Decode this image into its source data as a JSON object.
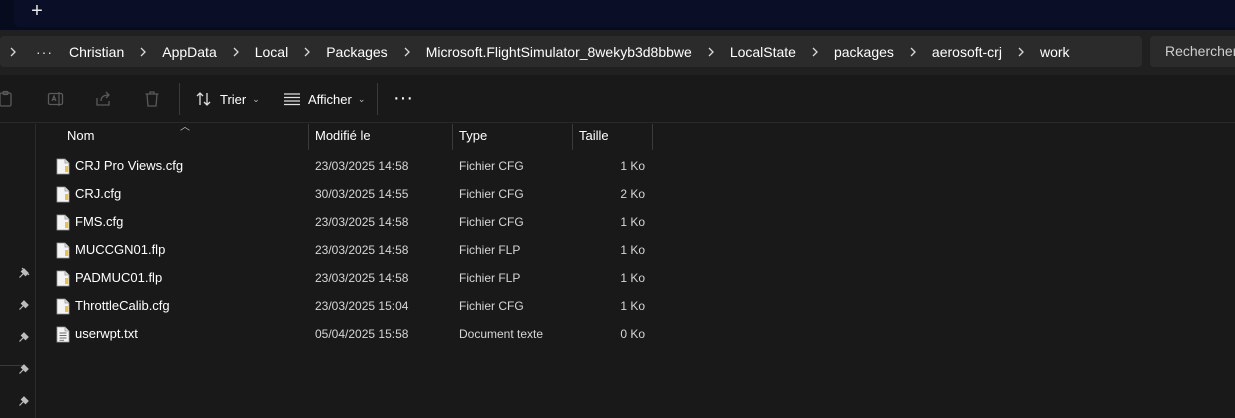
{
  "tabbar": {
    "new_tab": "+"
  },
  "address": {
    "overflow": "···",
    "crumbs": [
      "Christian",
      "AppData",
      "Local",
      "Packages",
      "Microsoft.FlightSimulator_8wekyb3d8bbwe",
      "LocalState",
      "packages",
      "aerosoft-crj",
      "work"
    ]
  },
  "search": {
    "placeholder": "Rechercher"
  },
  "toolbar": {
    "sort_label": "Trier",
    "view_label": "Afficher",
    "more_label": "···"
  },
  "columns": {
    "name": "Nom",
    "modified": "Modifié le",
    "type": "Type",
    "size": "Taille"
  },
  "files": [
    {
      "name": "CRJ Pro Views.cfg",
      "modified": "23/03/2025 14:58",
      "type": "Fichier CFG",
      "size": "1 Ko",
      "icon": "config-file-icon"
    },
    {
      "name": "CRJ.cfg",
      "modified": "30/03/2025 14:55",
      "type": "Fichier CFG",
      "size": "2 Ko",
      "icon": "config-file-icon"
    },
    {
      "name": "FMS.cfg",
      "modified": "23/03/2025 14:58",
      "type": "Fichier CFG",
      "size": "1 Ko",
      "icon": "config-file-icon"
    },
    {
      "name": "MUCCGN01.flp",
      "modified": "23/03/2025 14:58",
      "type": "Fichier FLP",
      "size": "1 Ko",
      "icon": "config-file-icon"
    },
    {
      "name": "PADMUC01.flp",
      "modified": "23/03/2025 14:58",
      "type": "Fichier FLP",
      "size": "1 Ko",
      "icon": "config-file-icon"
    },
    {
      "name": "ThrottleCalib.cfg",
      "modified": "23/03/2025 15:04",
      "type": "Fichier CFG",
      "size": "1 Ko",
      "icon": "config-file-icon"
    },
    {
      "name": "userwpt.txt",
      "modified": "05/04/2025 15:58",
      "type": "Document texte",
      "size": "0 Ko",
      "icon": "text-file-icon"
    }
  ],
  "colors": {
    "background": "#191919",
    "titlebar": "#060b1e",
    "addressbar": "#2b2b2b",
    "file_icon_accent": "#f2c230"
  }
}
